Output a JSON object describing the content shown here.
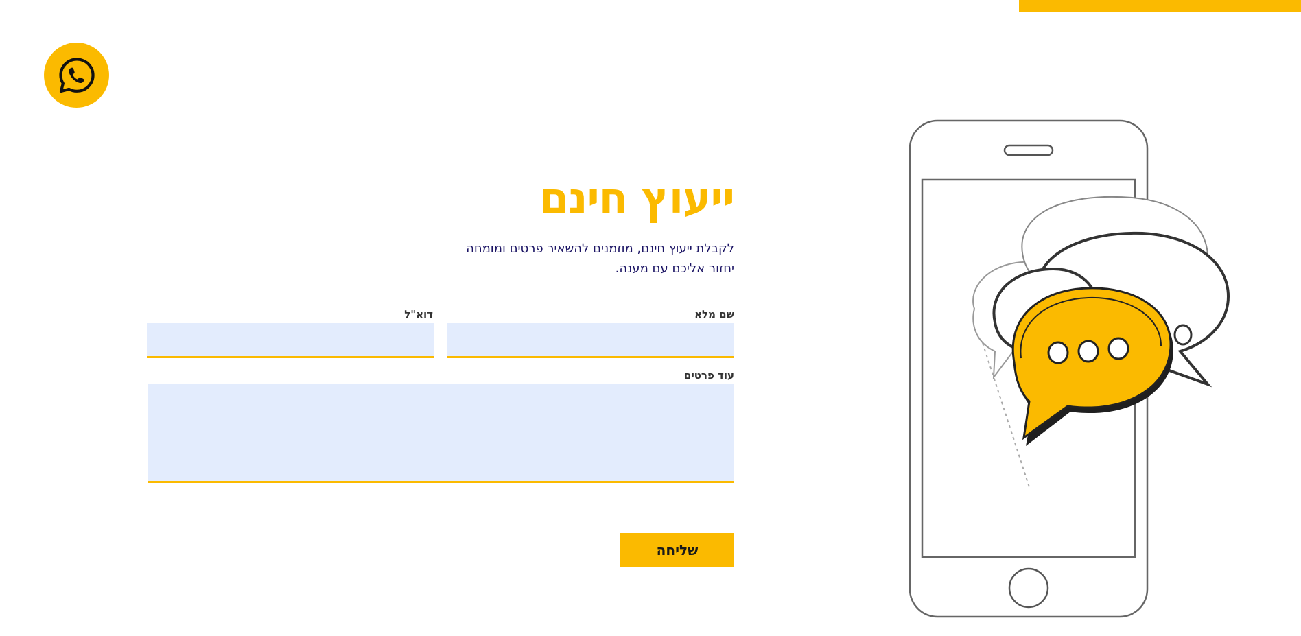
{
  "header": {
    "accent_color": "#FBBA00"
  },
  "whatsapp": {
    "icon": "whatsapp-icon"
  },
  "form": {
    "title": "ייעוץ חינם",
    "subtitle": "לקבלת ייעוץ חינם, מוזמנים להשאיר פרטים ומומחה יחזור אליכם עם מענה.",
    "fields": {
      "name_label": "שם מלא",
      "name_value": "",
      "email_label": "דוא\"ל",
      "email_value": "",
      "notes_label": "עוד פרטים",
      "notes_value": ""
    },
    "submit_label": "שליחה"
  },
  "illustration": {
    "icon": "phone-chat-bubbles-icon"
  },
  "colors": {
    "brand_yellow": "#FBBA00",
    "text_navy": "#1B1464",
    "input_bg": "#E3ECFD"
  }
}
